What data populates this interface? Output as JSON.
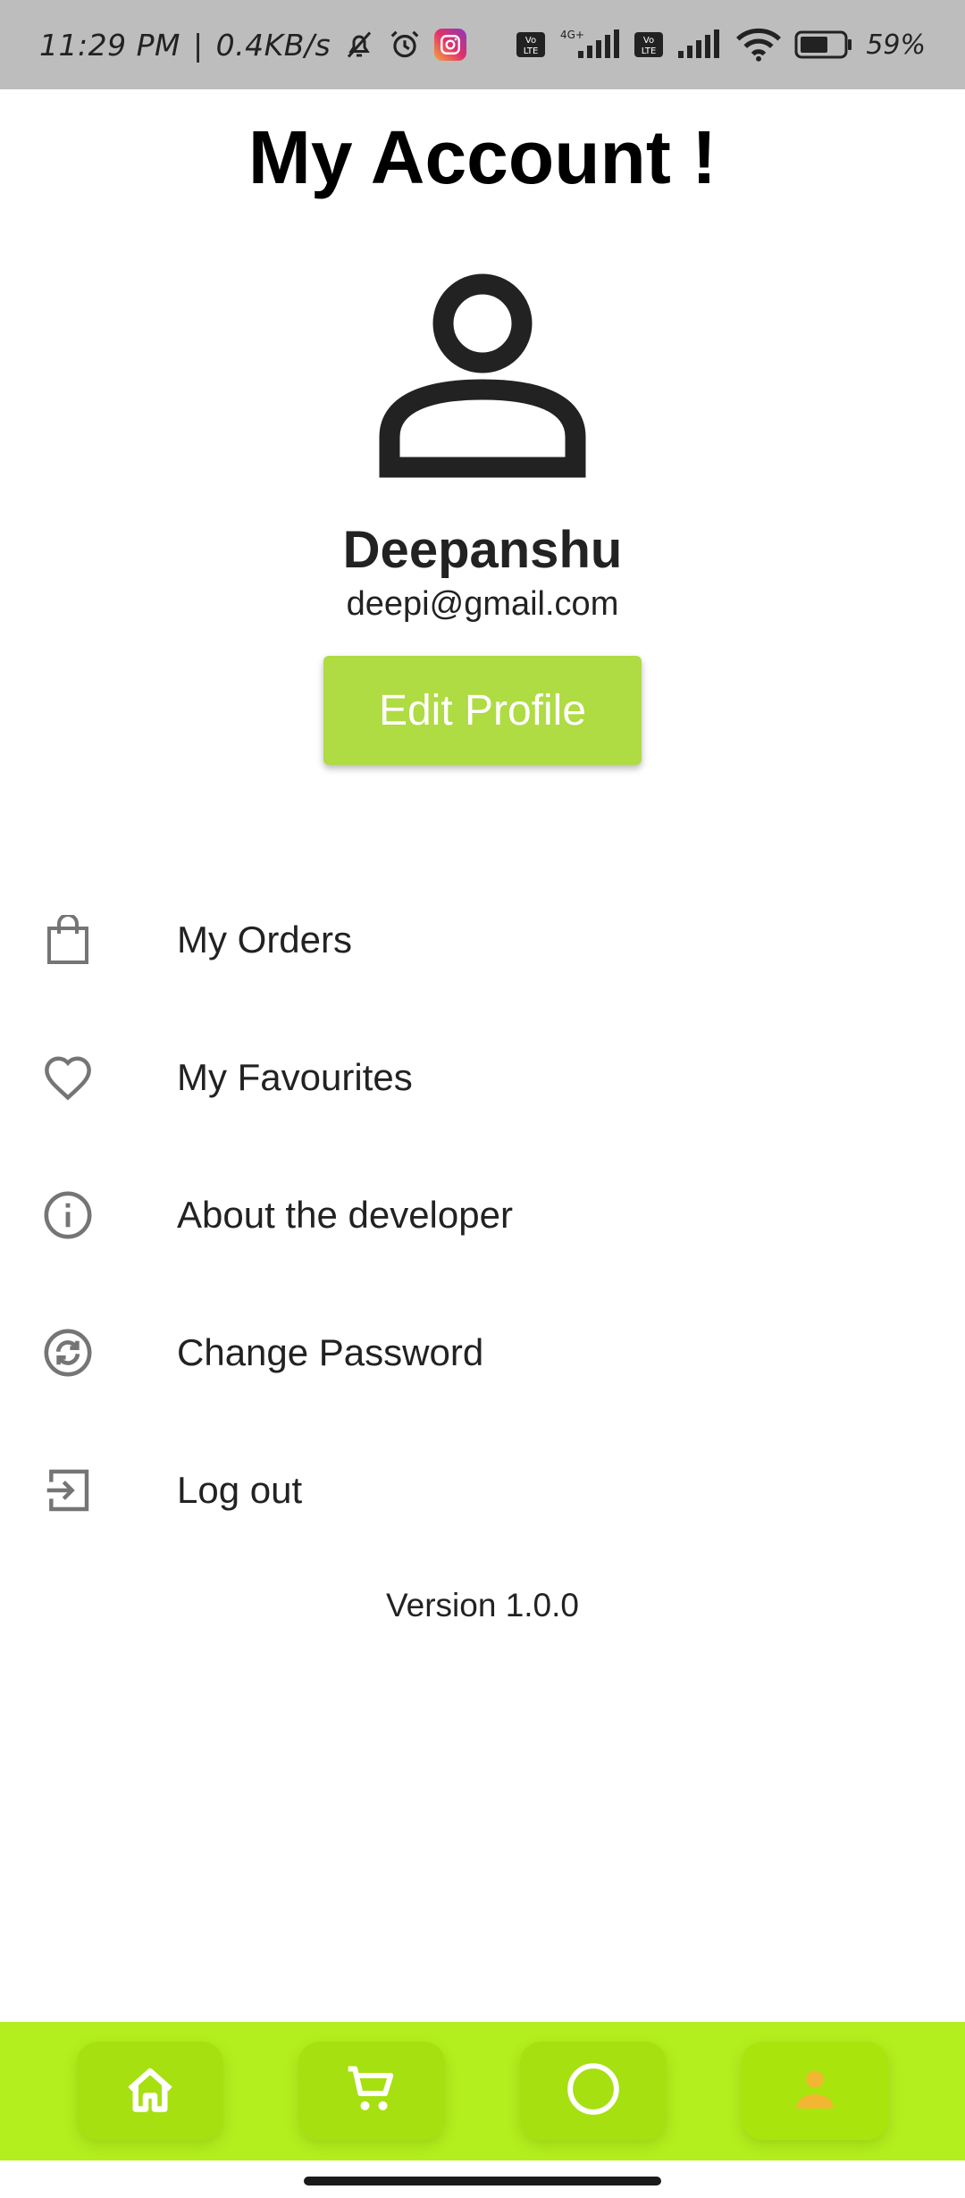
{
  "status_bar": {
    "time": "11:29 PM",
    "speed": "0.4KB/s",
    "battery": "59%",
    "icons": [
      "mute-bell-icon",
      "alarm-icon",
      "instagram-icon",
      "volte-icon",
      "signal-4g-icon",
      "volte-icon",
      "signal-icon",
      "wifi-icon",
      "battery-icon"
    ]
  },
  "header": {
    "title": "My Account !"
  },
  "profile": {
    "avatar_icon": "person-icon",
    "name": "Deepanshu",
    "email": "deepi@gmail.com",
    "edit_label": "Edit Profile"
  },
  "menu": {
    "items": [
      {
        "label": "My Orders",
        "icon": "shopping-bag-icon"
      },
      {
        "label": "My Favourites",
        "icon": "heart-icon"
      },
      {
        "label": "About the developer",
        "icon": "info-icon"
      },
      {
        "label": "Change Password",
        "icon": "refresh-icon"
      },
      {
        "label": "Log out",
        "icon": "logout-icon"
      }
    ]
  },
  "version": "Version 1.0.0",
  "bottom_nav": {
    "items": [
      {
        "icon": "home-icon",
        "active": false
      },
      {
        "icon": "cart-icon",
        "active": false
      },
      {
        "icon": "circle-icon",
        "active": false
      },
      {
        "icon": "person-icon",
        "active": true
      }
    ]
  },
  "colors": {
    "accent": "#afdb43",
    "nav_background": "#b3ee1e",
    "nav_active_icon": "#f2b632",
    "status_bar": "#bdbdbd"
  }
}
